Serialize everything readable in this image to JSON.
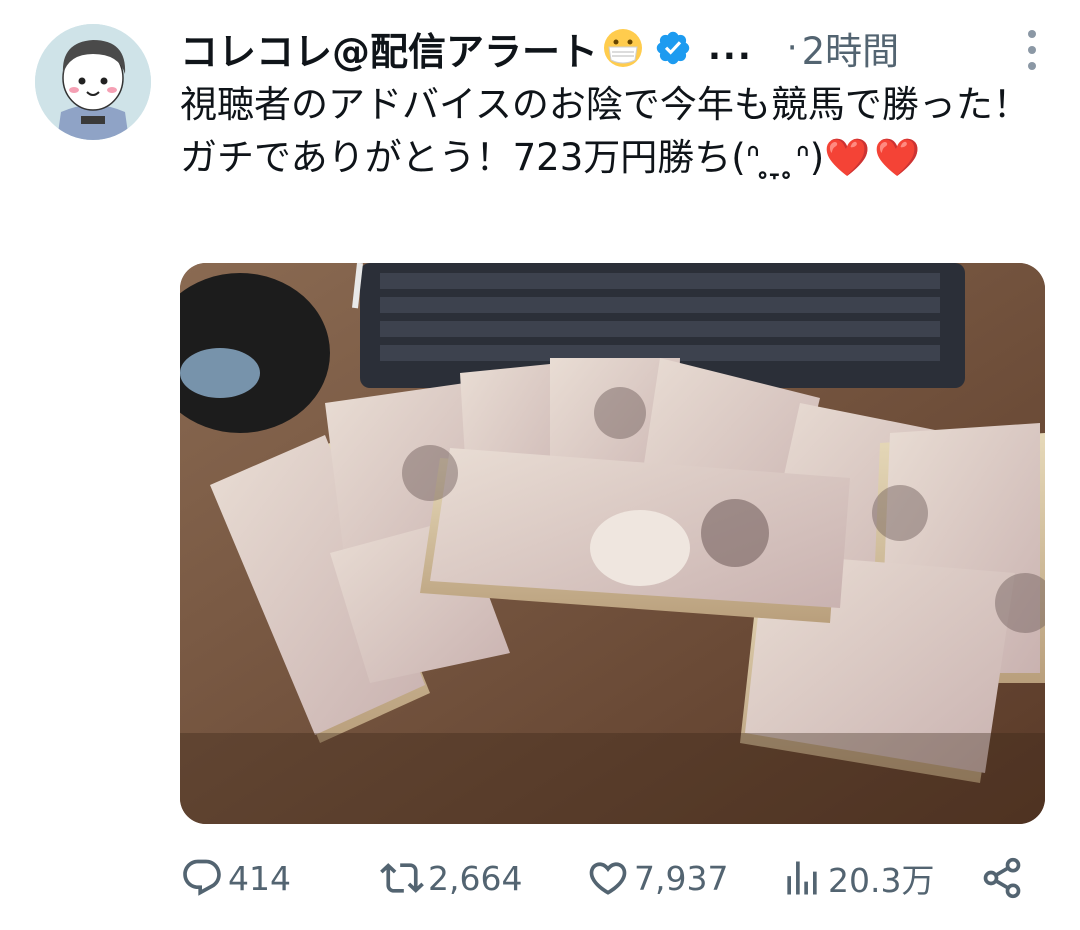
{
  "author": {
    "display_name": "コレコレ@配信アラート",
    "emoji": "face-with-medical-mask",
    "verified": true,
    "truncation": "...",
    "separator": "·",
    "timestamp": "2時間"
  },
  "tweet": {
    "text": "視聴者のアドバイスのお陰で今年も競馬で勝った！ガチでありがとう！723万円勝ち(ᐢ ̥ ̞ ̥ᐢ)",
    "hearts": "❤️❤️"
  },
  "media": {
    "icon": "photo-of-yen-bills"
  },
  "actions": {
    "reply_count": "414",
    "retweet_count": "2,664",
    "like_count": "7,937",
    "view_count": "20.3万"
  },
  "colors": {
    "text": "#0f1419",
    "secondary": "#536471",
    "verified": "#1d9bf0",
    "heart": "#e0245e"
  }
}
